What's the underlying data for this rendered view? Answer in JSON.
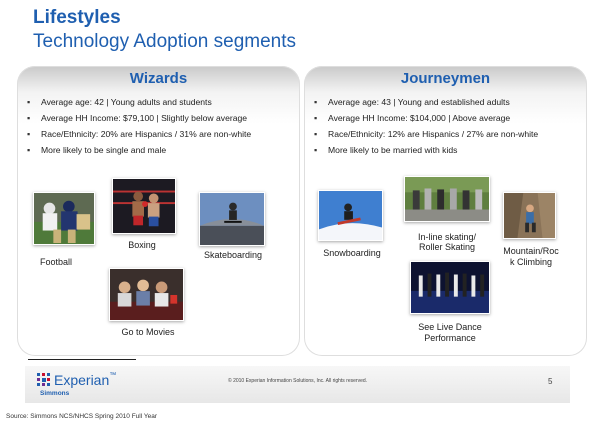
{
  "slide": {
    "title_line1": "Lifestyles",
    "title_line2": "Technology Adoption segments"
  },
  "wizards": {
    "heading": "Wizards",
    "bullets": [
      "Average age: 42 | Young adults and students",
      "Average HH Income: $79,100 | Slightly below average",
      "Race/Ethnicity: 20% are Hispanics / 31% are non-white",
      "More likely to be single and male"
    ],
    "activities": {
      "football": "Football",
      "boxing": "Boxing",
      "skateboarding": "Skateboarding",
      "movies": "Go to Movies"
    }
  },
  "journeymen": {
    "heading": "Journeymen",
    "bullets": [
      "Average  age: 43 | Young and established adults",
      "Average HH Income: $104,000 | Above average",
      "Race/Ethnicity: 12% are Hispanics / 27% are non-white",
      "More likely to be married with kids"
    ],
    "activities": {
      "snowboarding": "Snowboarding",
      "skating_line1": "In-line skating/",
      "skating_line2": "Roller Skating",
      "climbing_line1": "Mountain/Roc",
      "climbing_line2": "k Climbing",
      "dance_line1": "See  Live Dance",
      "dance_line2": "Performance"
    }
  },
  "footer": {
    "brand": "Experian",
    "brand_mark": "™",
    "sub_brand": "Simmons",
    "copyright": "© 2010 Experian Information Solutions, Inc.  All rights reserved.",
    "page_number": "5",
    "source": "Source:  Simmons NCS/NHCS Spring 2010 Full Year"
  },
  "colors": {
    "title_blue": "#1f5fb0",
    "panel_top": "#c9c9c9"
  }
}
